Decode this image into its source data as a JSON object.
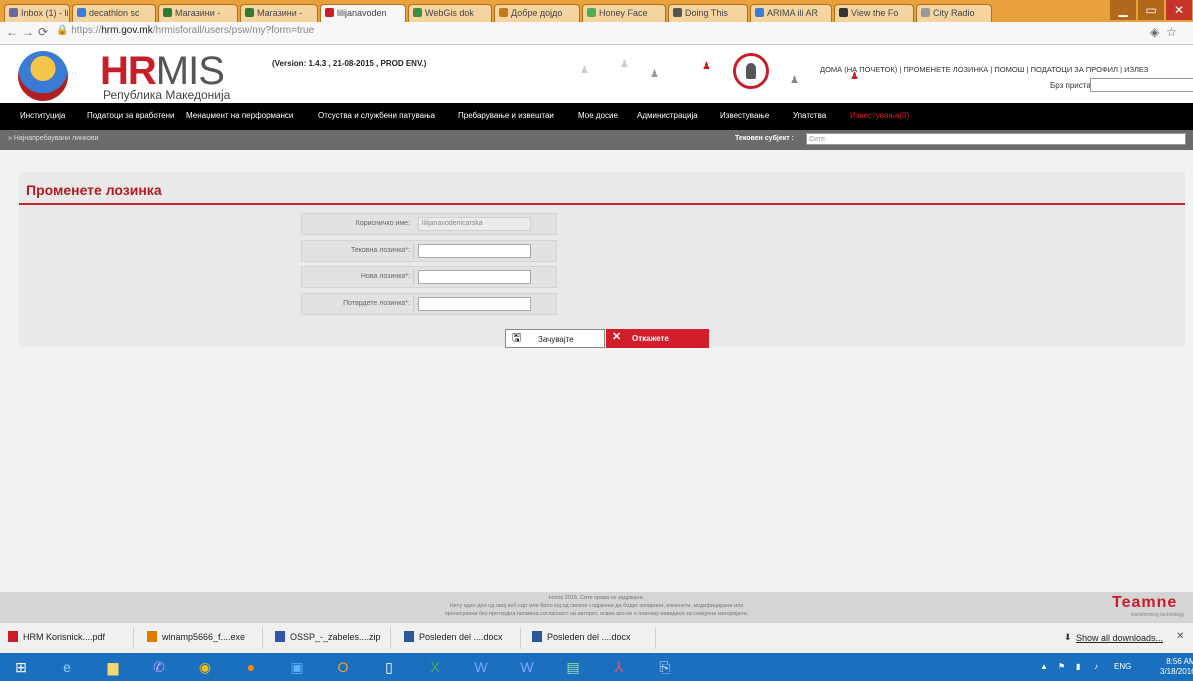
{
  "browser": {
    "tabs": [
      {
        "label": "Inbox (1) - li",
        "color": "#6a6aa0"
      },
      {
        "label": "decathlon sc",
        "color": "#3b7dd8"
      },
      {
        "label": "Магазини -",
        "color": "#2e7d32"
      },
      {
        "label": "Магазини -",
        "color": "#2e7d32"
      },
      {
        "label": "lilijanavoden",
        "color": "#c81e2a"
      },
      {
        "label": "WebGis dok",
        "color": "#3d8f3d"
      },
      {
        "label": "Добре дојдо",
        "color": "#c47a1a"
      },
      {
        "label": "Honey Face",
        "color": "#4caf50"
      },
      {
        "label": "Doing This",
        "color": "#555555"
      },
      {
        "label": "ARIMA ili AR",
        "color": "#3b7dd8"
      },
      {
        "label": "View the Fo",
        "color": "#333333"
      },
      {
        "label": "City Radio",
        "color": "#999999"
      }
    ],
    "url_scheme": "https://",
    "url_host": "hrm.gov.mk",
    "url_path": "/hrmisforall/users/psw/my?form=true"
  },
  "header": {
    "brand_hr": "HR",
    "brand_mis": "MIS",
    "subtitle": "Република Македонија",
    "version": "(Version: 1.4.3 , 21-08-2015 , PROD ENV.)",
    "top_links": "ДОМА (НА ПОЧЕТОК) | ПРОМЕНЕТЕ ЛОЗИНКА | ПОМОШ | ПОДАТОЦИ ЗА ПРОФИЛ | ИЗЛЕЗ",
    "staff_label": "Брз пристап:"
  },
  "nav": {
    "items": [
      "Институција",
      "Податоци за вработени",
      "Менаџмент на перформанси",
      "Отсуства и службени патувања",
      "Пребарување и извештаи",
      "Мое досие",
      "Администрација",
      "Известување",
      "Упатства",
      "Известувања(0)"
    ]
  },
  "breadcrumb": {
    "text": "» Најнапребаувани линкови",
    "subject_label": "Тековен субјект :",
    "subject_value": "Сите"
  },
  "form": {
    "title": "Променете лозинка",
    "username_label": "Корисничко име:",
    "username_value": "lilijanavodenicarska",
    "current_label": "Тековна лозинка*:",
    "new_label": "Нова лозинка*:",
    "confirm_label": "Потврдете лозинка*:",
    "save_label": "Зачувајте",
    "cancel_label": "Откажете"
  },
  "footer": {
    "line1": "Hrmis 2015. Сите права се задржани.",
    "line2": "Ниту еден дел од овој веб сајт или било кој од своите содржини да бидат копирани, изменети, модифицирани или",
    "line3": "пренесувани без претходна писмена согласност на авторот, освен ако не е поинаку наведено за севкупна материјали.",
    "brand": "Teamne",
    "brand_sub": "transforming technology"
  },
  "downloads": {
    "items": [
      {
        "label": "HRM Korisnick....pdf",
        "color": "#c81e2a"
      },
      {
        "label": "winamp5666_f....exe",
        "color": "#e07b00"
      },
      {
        "label": "OSSP_-_zabeles....zip",
        "color": "#3355aa"
      },
      {
        "label": "Posleden del ....docx",
        "color": "#2b5797"
      },
      {
        "label": "Posleden del ....docx",
        "color": "#2b5797"
      }
    ],
    "show_all": "Show all downloads..."
  },
  "taskbar": {
    "lang": "ENG",
    "time": "8:56 AM",
    "date": "3/18/2016"
  }
}
